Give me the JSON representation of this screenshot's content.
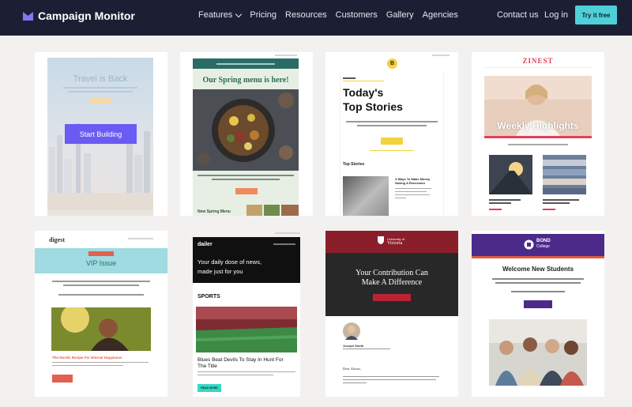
{
  "brand": {
    "name": "Campaign Monitor"
  },
  "nav": {
    "items": [
      "Features",
      "Pricing",
      "Resources",
      "Customers",
      "Gallery",
      "Agencies"
    ],
    "contact": "Contact us",
    "login": "Log in",
    "try": "Try it free"
  },
  "templates": {
    "travel": {
      "title": "Travel is Back",
      "cta": "Start Building"
    },
    "spring": {
      "title": "Our Spring menu is here!",
      "footer": "New Spring Menu"
    },
    "stories": {
      "badge": "B",
      "title_line1": "Today's",
      "title_line2": "Top Stories",
      "section": "Top Stories",
      "article": "3 Ways To Make Money Saving A Recession"
    },
    "zinest": {
      "brand": "ZINEST",
      "headline": "Weekly Highlights"
    },
    "digest": {
      "brand": "digest",
      "banner": "VIP Issue",
      "article": "The Nordic Recipe For Eternal Happiness"
    },
    "dailer": {
      "brand": "dailer",
      "line1": "Your daily dose of news,",
      "line2": "made just for you",
      "section": "SPORTS",
      "headline_line1": "Blues Beat Devils To Stay In Hunt For",
      "headline_line2": "The Title",
      "cta": "READ MORE"
    },
    "victoria": {
      "brand_line1": "University of",
      "brand_line2": "Victoria",
      "headline_line1": "Your Contribution Can",
      "headline_line2": "Make A Difference",
      "person": "Joseph Smith",
      "greeting": "Dear Alison,"
    },
    "bond": {
      "brand_line1": "BOND",
      "brand_line2": "College",
      "headline": "Welcome New Students"
    }
  },
  "colors": {
    "nav_bg": "#1c1f33",
    "accent": "#4fd0d8",
    "cta_purple": "#6a5bf2",
    "victoria_red": "#8b1e2b",
    "bond_purple": "#4b2a8a"
  }
}
